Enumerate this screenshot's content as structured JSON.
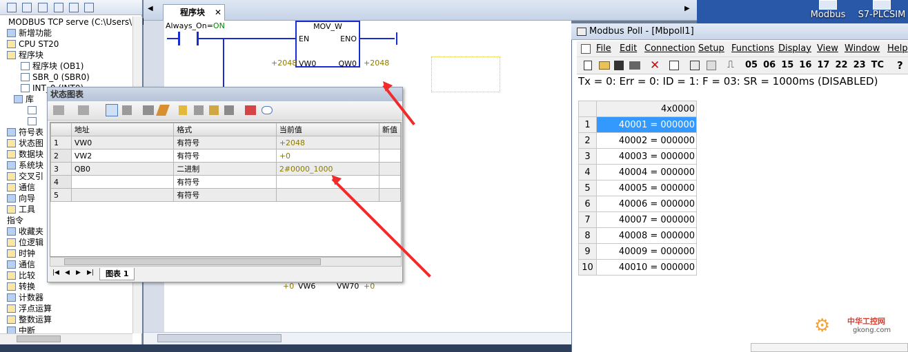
{
  "tree": {
    "root": "MODBUS TCP serve (C:\\Users\\Publ",
    "items": [
      {
        "label": "新增功能",
        "indent": 0
      },
      {
        "label": "CPU ST20",
        "indent": 0
      },
      {
        "label": "程序块",
        "indent": 0
      },
      {
        "label": "程序块 (OB1)",
        "indent": 2
      },
      {
        "label": "SBR_0 (SBR0)",
        "indent": 2
      },
      {
        "label": "INT_0 (INT0)",
        "indent": 2
      },
      {
        "label": "库",
        "indent": 1
      },
      {
        "label": "",
        "indent": 3
      },
      {
        "label": "",
        "indent": 3
      },
      {
        "label": "符号表",
        "indent": 0
      },
      {
        "label": "状态图",
        "indent": 0
      },
      {
        "label": "数据块",
        "indent": 0
      },
      {
        "label": "系统块",
        "indent": 0
      },
      {
        "label": "交叉引",
        "indent": 0
      },
      {
        "label": "通信",
        "indent": 0
      },
      {
        "label": "向导",
        "indent": 0
      },
      {
        "label": "工具",
        "indent": 0
      },
      {
        "label": "指令",
        "indent": -1
      },
      {
        "label": "收藏夹",
        "indent": 0
      },
      {
        "label": "位逻辑",
        "indent": 0
      },
      {
        "label": "时钟",
        "indent": 0
      },
      {
        "label": "通信",
        "indent": 0
      },
      {
        "label": "比较",
        "indent": 0
      },
      {
        "label": "转换",
        "indent": 0
      },
      {
        "label": "计数器",
        "indent": 0
      },
      {
        "label": "浮点运算",
        "indent": 0
      },
      {
        "label": "整数运算",
        "indent": 0
      },
      {
        "label": "中断",
        "indent": 0
      }
    ]
  },
  "editor": {
    "tab_label": "程序块",
    "contact_label": "Always_On",
    "contact_state": "ON",
    "block_title": "MOV_W",
    "en": "EN",
    "eno": "ENO",
    "in_value": "+2048",
    "in_operand": "VW0",
    "out_operand": "QW0",
    "out_value": "+2048",
    "lower_in_value": "+0",
    "lower_in_operand": "VW6",
    "lower_out_operand": "VW70",
    "lower_out_value": "+0"
  },
  "status_chart": {
    "title": "状态图表",
    "columns": [
      "",
      "地址",
      "格式",
      "当前值",
      "新值"
    ],
    "rows": [
      {
        "n": "1",
        "addr": "VW0",
        "fmt": "有符号",
        "val": "+2048"
      },
      {
        "n": "2",
        "addr": "VW2",
        "fmt": "有符号",
        "val": "+0"
      },
      {
        "n": "3",
        "addr": "QB0",
        "fmt": "二进制",
        "val": "2#0000_1000"
      },
      {
        "n": "4",
        "addr": "",
        "fmt": "有符号",
        "val": ""
      },
      {
        "n": "5",
        "addr": "",
        "fmt": "有符号",
        "val": ""
      }
    ],
    "sheet_tab": "图表 1"
  },
  "modbus_poll": {
    "title": "Modbus Poll - [Mbpoll1]",
    "menu": [
      "File",
      "Edit",
      "Connection",
      "Setup",
      "Functions",
      "Display",
      "View",
      "Window",
      "Help"
    ],
    "function_codes": [
      "05",
      "06",
      "15",
      "16",
      "17",
      "22",
      "23",
      "TC"
    ],
    "status_line": "Tx = 0: Err = 0: ID = 1: F = 03: SR = 1000ms  (DISABLED)",
    "column_header": "4x0000",
    "rows": [
      {
        "n": "1",
        "value": "40001 = 000000"
      },
      {
        "n": "2",
        "value": "40002 = 000000"
      },
      {
        "n": "3",
        "value": "40003 = 000000"
      },
      {
        "n": "4",
        "value": "40004 = 000000"
      },
      {
        "n": "5",
        "value": "40005 = 000000"
      },
      {
        "n": "6",
        "value": "40006 = 000000"
      },
      {
        "n": "7",
        "value": "40007 = 000000"
      },
      {
        "n": "8",
        "value": "40008 = 000000"
      },
      {
        "n": "9",
        "value": "40009 = 000000"
      },
      {
        "n": "10",
        "value": "40010 = 000000"
      }
    ],
    "selected_row": "1"
  },
  "desktop": {
    "icons": [
      "Modbus",
      "S7-PLCSIM"
    ],
    "watermark_text": "中华工控网",
    "watermark_url": "gkong.com"
  },
  "colors": {
    "modbus_selection": "#3399ff",
    "value_green": "#008800",
    "value_olive": "#8a7a00",
    "arrow_red": "#ef2b2b"
  }
}
